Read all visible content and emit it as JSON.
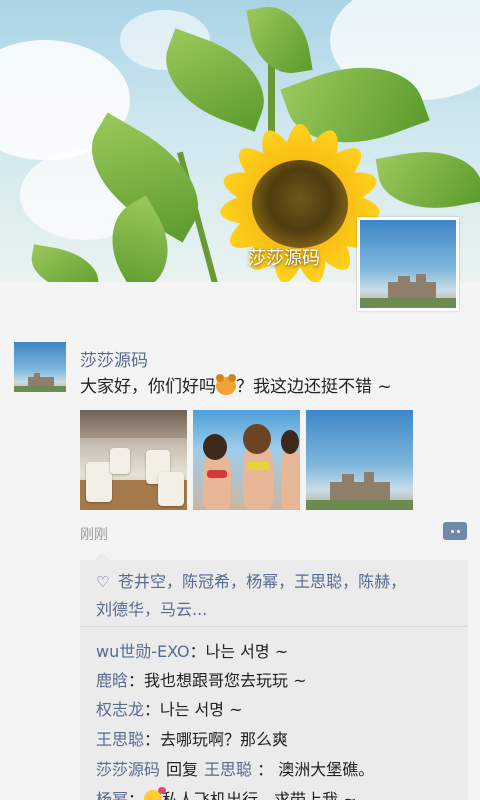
{
  "cover": {
    "name": "莎莎源码"
  },
  "post": {
    "author": "莎莎源码",
    "text_before_emoji": "大家好，你们好吗",
    "text_after_emoji": "？我这边还挺不错 ~",
    "time": "刚刚"
  },
  "likes": {
    "names": [
      "苍井空",
      "陈冠希",
      "杨幂",
      "王思聪",
      "陈赫",
      "刘德华",
      "马云..."
    ],
    "separator": "，"
  },
  "comments": [
    {
      "name": "wu世勋-EXO",
      "text": "：나는 서명 ~"
    },
    {
      "name": "鹿晗",
      "text": "：我也想跟哥您去玩玩 ~"
    },
    {
      "name": "权志龙",
      "text": "：나는 서명 ~"
    },
    {
      "name": "王思聪",
      "text": "：去哪玩啊？那么爽"
    },
    {
      "name": "莎莎源码",
      "reply_word": "回复",
      "reply_to": "王思聪",
      "text": " ： 澳洲大堡礁。"
    },
    {
      "name": "杨幂",
      "text_before_emoji": "：",
      "text_after_emoji": "私人飞机出行，求带上我 ~"
    }
  ],
  "colors": {
    "name_link": "#566a92",
    "comment_bg": "#ebebeb",
    "comment_button": "#7189a8"
  }
}
